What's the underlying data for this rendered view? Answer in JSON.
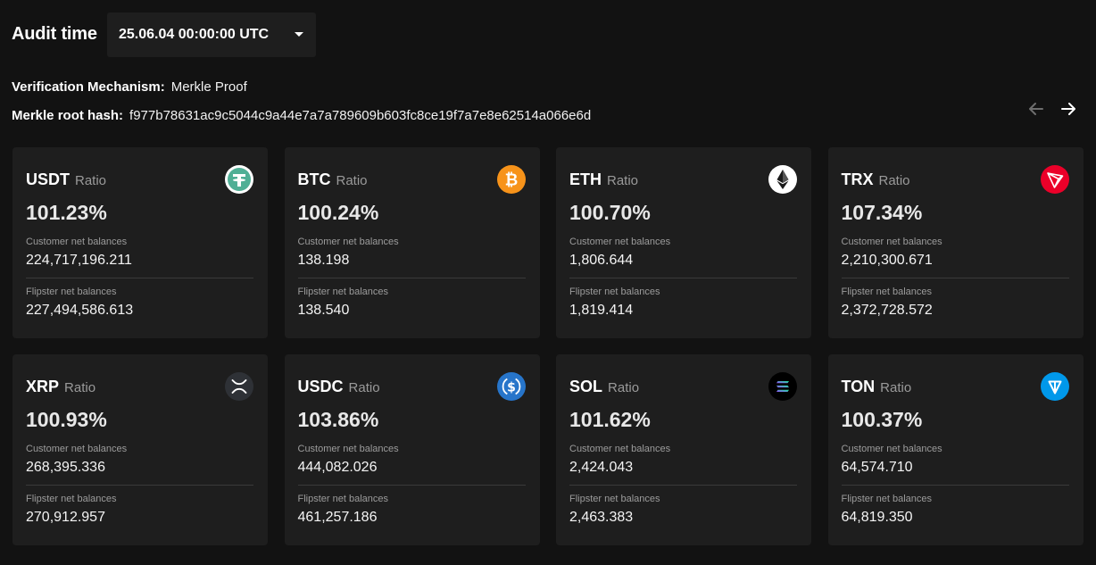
{
  "header": {
    "audit_time_label": "Audit time",
    "audit_time_value": "25.06.04 00:00:00 UTC"
  },
  "info": {
    "mechanism_label": "Verification Mechanism:",
    "mechanism_value": "Merkle Proof",
    "root_hash_label": "Merkle root hash:",
    "root_hash_value": "f977b78631ac9c5044c9a44e7a7a789609b603fc8ce19f7a7e8e62514a066e6d"
  },
  "labels": {
    "ratio": "Ratio",
    "customer": "Customer net balances",
    "flipster": "Flipster net balances"
  },
  "cards": [
    {
      "symbol": "USDT",
      "ratio": "101.23%",
      "customer": "224,717,196.211",
      "flipster": "227,494,586.613",
      "icon": "usdt-icon",
      "color": "#50af95"
    },
    {
      "symbol": "BTC",
      "ratio": "100.24%",
      "customer": "138.198",
      "flipster": "138.540",
      "icon": "btc-icon",
      "color": "#f7931a"
    },
    {
      "symbol": "ETH",
      "ratio": "100.70%",
      "customer": "1,806.644",
      "flipster": "1,819.414",
      "icon": "eth-icon",
      "color": "#ffffff"
    },
    {
      "symbol": "TRX",
      "ratio": "107.34%",
      "customer": "2,210,300.671",
      "flipster": "2,372,728.572",
      "icon": "trx-icon",
      "color": "#eb0029"
    },
    {
      "symbol": "XRP",
      "ratio": "100.93%",
      "customer": "268,395.336",
      "flipster": "270,912.957",
      "icon": "xrp-icon",
      "color": "#23292f"
    },
    {
      "symbol": "USDC",
      "ratio": "103.86%",
      "customer": "444,082.026",
      "flipster": "461,257.186",
      "icon": "usdc-icon",
      "color": "#2775ca"
    },
    {
      "symbol": "SOL",
      "ratio": "101.62%",
      "customer": "2,424.043",
      "flipster": "2,463.383",
      "icon": "sol-icon",
      "color": "#000000"
    },
    {
      "symbol": "TON",
      "ratio": "100.37%",
      "customer": "64,574.710",
      "flipster": "64,819.350",
      "icon": "ton-icon",
      "color": "#0098ea"
    }
  ]
}
